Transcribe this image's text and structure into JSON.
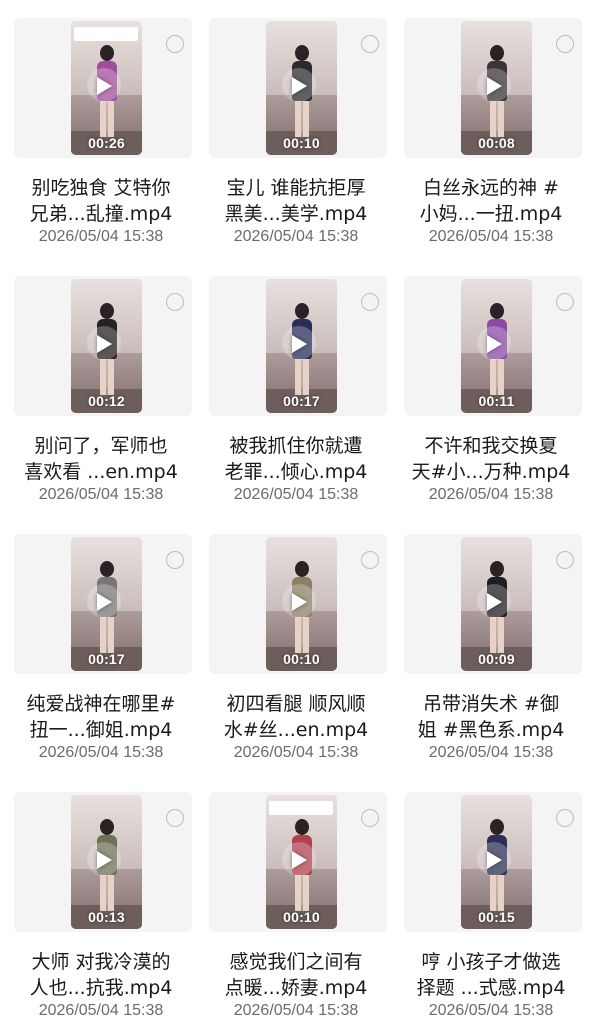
{
  "videos": [
    {
      "title": "别吃独食 艾特你\n兄弟...乱撞.mp4",
      "date": "2026/05/04 15:38",
      "duration": "00:26",
      "outfit": "#a04c9d",
      "sticker": true
    },
    {
      "title": "宝儿 谁能抗拒厚\n黑美...美学.mp4",
      "date": "2026/05/04 15:38",
      "duration": "00:10",
      "outfit": "#2b2b2e",
      "sticker": false
    },
    {
      "title": "白丝永远的神 #\n小妈...一扭.mp4",
      "date": "2026/05/04 15:38",
      "duration": "00:08",
      "outfit": "#3a3536",
      "sticker": false
    },
    {
      "title": "别问了，军师也\n喜欢看 ...en.mp4",
      "date": "2026/05/04 15:38",
      "duration": "00:12",
      "outfit": "#262123",
      "sticker": false
    },
    {
      "title": "被我抓住你就遭\n老罪...倾心.mp4",
      "date": "2026/05/04 15:38",
      "duration": "00:17",
      "outfit": "#2a2c5a",
      "sticker": false
    },
    {
      "title": "不许和我交换夏\n天#小...万种.mp4",
      "date": "2026/05/04 15:38",
      "duration": "00:11",
      "outfit": "#8a4aa6",
      "sticker": false
    },
    {
      "title": "纯爱战神在哪里#\n扭一...御姐.mp4",
      "date": "2026/05/04 15:38",
      "duration": "00:17",
      "outfit": "#7a7676",
      "sticker": false
    },
    {
      "title": "初四看腿 顺风顺\n水#丝...en.mp4",
      "date": "2026/05/04 15:38",
      "duration": "00:10",
      "outfit": "#8c8064",
      "sticker": false
    },
    {
      "title": "吊带消失术 #御\n姐 #黑色系.mp4",
      "date": "2026/05/04 15:38",
      "duration": "00:09",
      "outfit": "#1f1d1f",
      "sticker": false
    },
    {
      "title": "大师 对我冷漠的\n人也...抗我.mp4",
      "date": "2026/05/04 15:38",
      "duration": "00:13",
      "outfit": "#6b7057",
      "sticker": false
    },
    {
      "title": "感觉我们之间有\n点暖...娇妻.mp4",
      "date": "2026/05/04 15:38",
      "duration": "00:10",
      "outfit": "#b0404e",
      "sticker": true
    },
    {
      "title": "哼 小孩子才做选\n择题 ...式感.mp4",
      "date": "2026/05/04 15:38",
      "duration": "00:15",
      "outfit": "#2a3055",
      "sticker": false
    }
  ],
  "icons": {
    "play": "play-icon",
    "select": "select-circle-icon"
  },
  "colors": {
    "title": "#1a1a1a",
    "date": "#6b6b6b",
    "card_bg": "#f4f4f5",
    "radio_border": "#bdbdbd"
  }
}
